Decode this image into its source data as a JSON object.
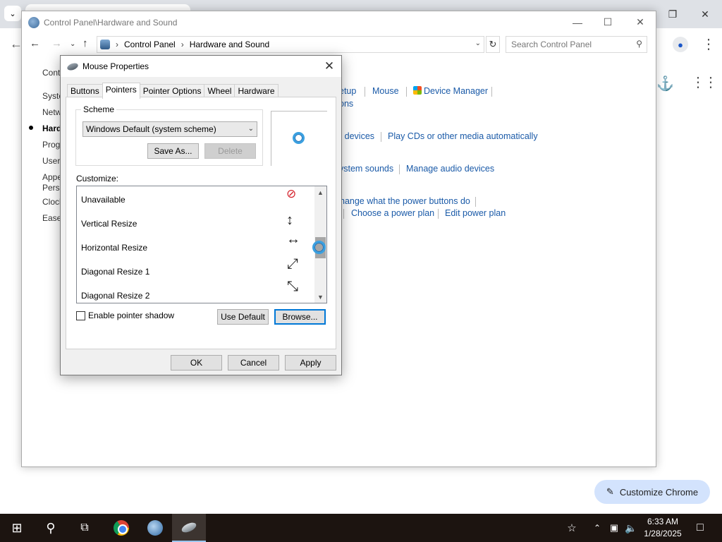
{
  "chrome": {
    "customize_label": "Customize Chrome"
  },
  "cp": {
    "title": "Control Panel\\Hardware and Sound",
    "breadcrumb": [
      "Control Panel",
      "Hardware and Sound"
    ],
    "search_placeholder": "Search Control Panel",
    "sidebar": [
      "Cont",
      "Syste",
      "Netw",
      "Hard",
      "Prog",
      "User",
      "Appe",
      "Perso",
      "Clock",
      "Ease"
    ],
    "links": {
      "setup": "etup",
      "mouse": "Mouse",
      "device_manager": "Device Manager",
      "options": "ons",
      "devices": "r devices",
      "play_cds": "Play CDs or other media automatically",
      "system_sounds": "ystem sounds",
      "audio_devices": "Manage audio devices",
      "power_buttons": "hange what the power buttons do",
      "power_plan": "Choose a power plan",
      "edit_power_plan": "Edit power plan"
    }
  },
  "dialog": {
    "title": "Mouse Properties",
    "tabs": [
      "Buttons",
      "Pointers",
      "Pointer Options",
      "Wheel",
      "Hardware"
    ],
    "active_tab": "Pointers",
    "scheme_label": "Scheme",
    "scheme_value": "Windows Default (system scheme)",
    "save_as": "Save As...",
    "delete": "Delete",
    "customize_label": "Customize:",
    "cursors": [
      "Unavailable",
      "Vertical Resize",
      "Horizontal Resize",
      "Diagonal Resize 1",
      "Diagonal Resize 2"
    ],
    "shadow_label": "Enable pointer shadow",
    "shadow_checked": false,
    "use_default": "Use Default",
    "browse": "Browse...",
    "ok": "OK",
    "cancel": "Cancel",
    "apply": "Apply"
  },
  "taskbar": {
    "time": "6:33 AM",
    "date": "1/28/2025"
  }
}
